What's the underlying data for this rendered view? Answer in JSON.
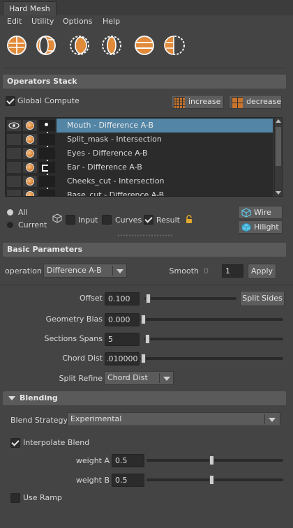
{
  "window": {
    "title": "Hard Mesh"
  },
  "menu": [
    "Edit",
    "Utility",
    "Options",
    "Help"
  ],
  "toolbar": {
    "icons": [
      "union-sphere-icon",
      "difference-sphere-icon",
      "intersection-sphere-icon",
      "split-sphere-icon",
      "slice-sphere-icon",
      "cut-sphere-icon"
    ]
  },
  "operators_stack": {
    "header": "Operators Stack",
    "global_compute": {
      "label": "Global Compute",
      "checked": true
    },
    "increase_label": "increase",
    "decrease_label": "decrease",
    "items": [
      {
        "label": "Mouth - Difference A-B",
        "selected": true
      },
      {
        "label": "Split_mask - Intersection",
        "selected": false
      },
      {
        "label": "Eyes - Difference A-B",
        "selected": false
      },
      {
        "label": "Ear - Difference A-B",
        "selected": false
      },
      {
        "label": "Cheeks_cut - Intersection",
        "selected": false
      },
      {
        "label": "Base_cut - Difference A-B",
        "selected": false
      }
    ],
    "scope": {
      "all_label": "All",
      "current_label": "Current",
      "selected": "All"
    },
    "display": {
      "input_label": "Input",
      "input_checked": false,
      "curves_label": "Curves",
      "curves_checked": false,
      "result_label": "Result",
      "result_checked": true
    },
    "wire_label": "Wire",
    "hilight_label": "Hilight"
  },
  "basic_parameters": {
    "header": "Basic Parameters",
    "operation_label": "operation",
    "operation_value": "Difference A-B",
    "smooth_label": "Smooth",
    "smooth_dim_value": "0",
    "smooth_value": "1",
    "apply_label": "Apply",
    "offset_label": "Offset",
    "offset_value": "0.100",
    "offset_slider": 0.05,
    "split_sides_label": "Split Sides",
    "geometry_bias_label": "Geometry Bias",
    "geometry_bias_value": "0.000",
    "geometry_bias_slider": 0.0,
    "sections_spans_label": "Sections Spans",
    "sections_spans_value": "5",
    "sections_spans_slider": 0.03,
    "chord_dist_label": "Chord Dist",
    "chord_dist_value": ".010000",
    "chord_dist_slider": 0.0,
    "split_refine_label": "Split Refine",
    "split_refine_value": "Chord Dist"
  },
  "blending": {
    "header": "Blending",
    "blend_strategy_label": "Blend Strategy",
    "blend_strategy_value": "Experimental",
    "interpolate_label": "Interpolate Blend",
    "interpolate_checked": true,
    "weight_a_label": "weight A",
    "weight_a_value": "0.5",
    "weight_a_slider": 0.5,
    "weight_b_label": "weight B",
    "weight_b_value": "0.5",
    "weight_b_slider": 0.5,
    "use_ramp_label": "Use Ramp",
    "use_ramp_checked": false
  },
  "colors": {
    "selection": "#5285a6",
    "panel": "#444444",
    "header": "#5a5a5a",
    "accent_orange": "#e08a3a",
    "wire_cyan": "#5fc6e8"
  }
}
